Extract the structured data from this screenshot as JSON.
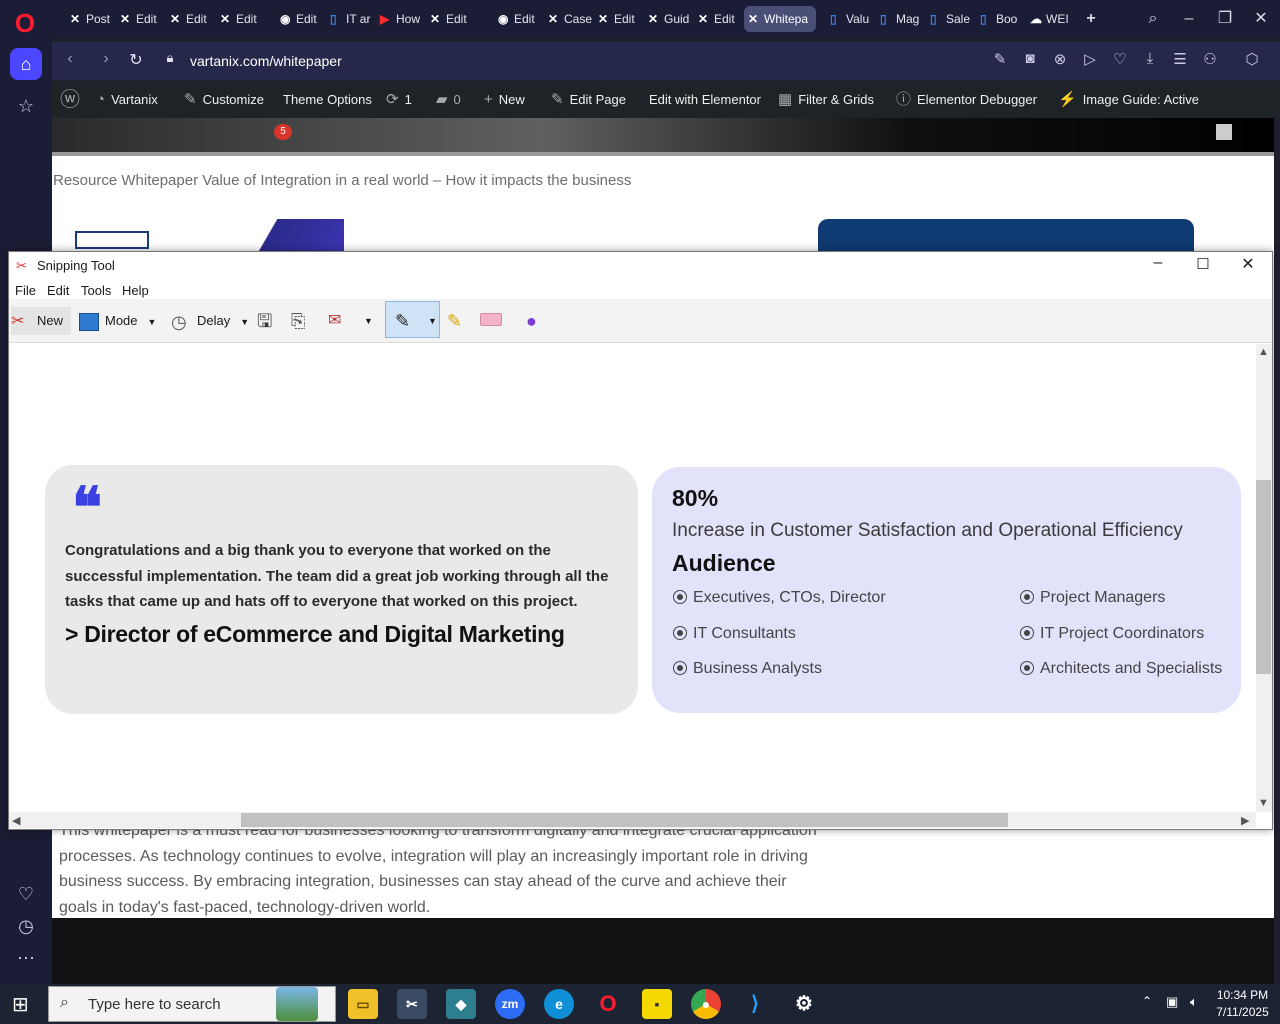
{
  "browser": {
    "tabs": [
      {
        "label": "Post",
        "icon": "x-icon"
      },
      {
        "label": "Edit",
        "icon": "x-icon"
      },
      {
        "label": "Edit",
        "icon": "x-icon"
      },
      {
        "label": "Edit",
        "icon": "x-icon"
      },
      {
        "label": "Edit",
        "icon": "wp-icon"
      },
      {
        "label": "IT ar",
        "icon": "doc-icon"
      },
      {
        "label": "How",
        "icon": "youtube-icon"
      },
      {
        "label": "Edit",
        "icon": "x-icon"
      },
      {
        "label": "Edit",
        "icon": "wp-icon"
      },
      {
        "label": "Case",
        "icon": "x-icon"
      },
      {
        "label": "Edit",
        "icon": "x-icon"
      },
      {
        "label": "Guid",
        "icon": "x-icon"
      },
      {
        "label": "Edit",
        "icon": "x-icon"
      },
      {
        "label": "Whitepa",
        "icon": "x-icon"
      },
      {
        "label": "Valu",
        "icon": "doc-icon"
      },
      {
        "label": "Mag",
        "icon": "doc-icon"
      },
      {
        "label": "Sale",
        "icon": "doc-icon"
      },
      {
        "label": "Boo",
        "icon": "doc-icon"
      },
      {
        "label": "WEI",
        "icon": "cloud-icon"
      }
    ],
    "url": "vartanix.com/whitepaper",
    "accent": "#ff1b2d"
  },
  "wpbar": {
    "site": "Vartanix",
    "customize": "Customize",
    "theme_options": "Theme Options",
    "updates": "1",
    "comments": "0",
    "new": "New",
    "edit_page": "Edit Page",
    "elementor": "Edit with Elementor",
    "filter": "Filter & Grids",
    "debugger": "Elementor Debugger",
    "image_guide": "Image Guide: Active"
  },
  "page": {
    "notif_count": "5",
    "breadcrumb": "Resource Whitepaper Value of Integration in a real world – How it impacts the business",
    "body_text": "This whitepaper is a must read for businesses looking to transform digitally and integrate crucial application processes. As technology continues to evolve, integration will play an increasingly important role in driving business success. By embracing integration, businesses can stay ahead of the curve and achieve their goals in today's fast-paced, technology-driven world."
  },
  "snip": {
    "title": "Snipping Tool",
    "menu": [
      "File",
      "Edit",
      "Tools",
      "Help"
    ],
    "new_label": "New",
    "mode_label": "Mode",
    "delay_label": "Delay"
  },
  "testimonial": {
    "quote": "Congratulations and a big thank you to everyone that worked on the successful implementation. The team did a great job working through all the tasks that came up and hats off to everyone that worked on this project.",
    "author": "> Director of eCommerce and Digital Marketing",
    "quote_color": "#3b40e0"
  },
  "stats": {
    "value": "80%",
    "description": "Increase in Customer Satisfaction and Operational Efficiency",
    "audience_title": "Audience",
    "audience": [
      "Executives, CTOs, Director",
      "Project Managers",
      "IT Consultants",
      "IT Project Coordinators",
      "Business Analysts",
      "Architects and Specialists"
    ],
    "card_color": "#e2e3fb"
  },
  "taskbar": {
    "search_placeholder": "Type here to search",
    "time": "10:34 PM",
    "date": "7/11/2025"
  }
}
